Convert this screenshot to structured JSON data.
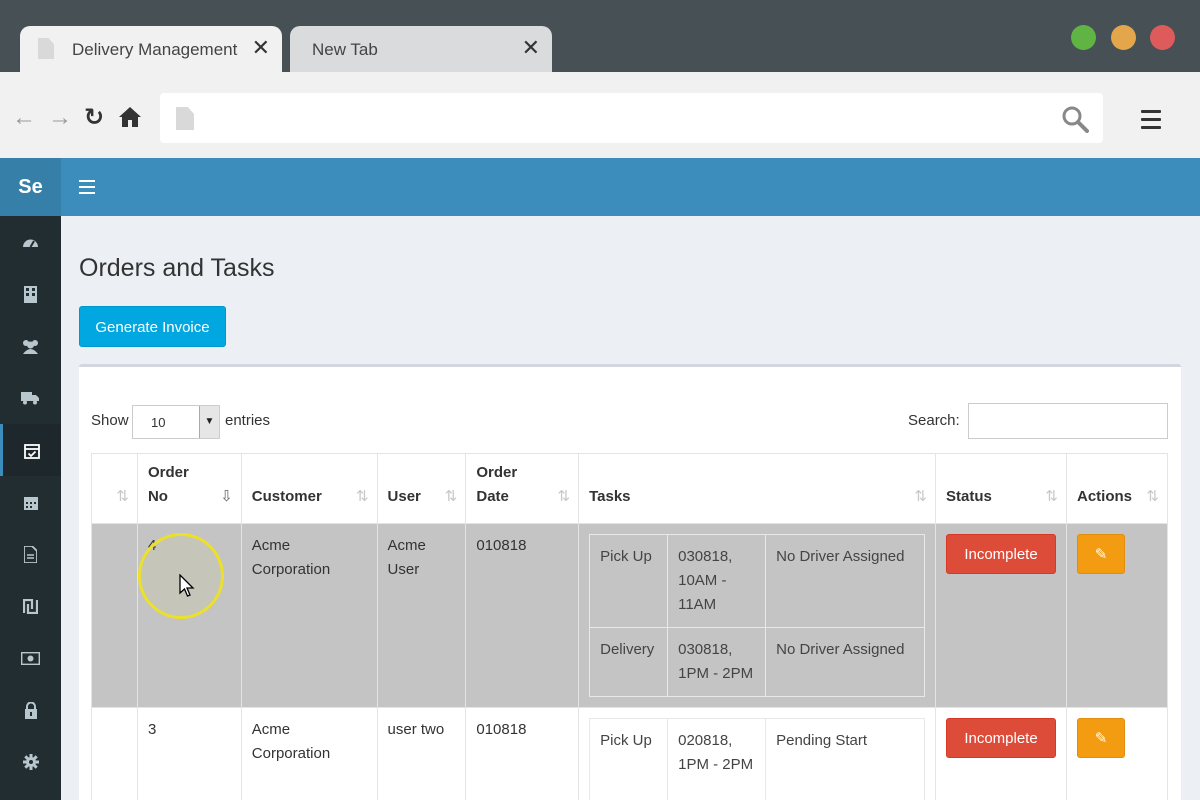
{
  "browser": {
    "tabs": [
      {
        "title": "Delivery Management",
        "close": "✕"
      },
      {
        "title": "New Tab",
        "close": "✕"
      }
    ],
    "url": "",
    "icons": {
      "back": "back-arrow-icon",
      "forward": "forward-arrow-icon",
      "reload": "reload-icon",
      "home": "home-icon",
      "search": "search-icon",
      "menu": "menu-icon"
    },
    "lights": {
      "green": "#5fb443",
      "yellow": "#e3a64a",
      "red": "#dd5c5b"
    }
  },
  "app": {
    "brand": "Se",
    "sidebar_icons": [
      "dashboard-icon",
      "building-icon",
      "users-icon",
      "truck-icon",
      "calendar-check-icon",
      "calendar-icon",
      "file-icon",
      "shekel-icon",
      "money-icon",
      "lock-icon",
      "gear-icon"
    ],
    "accent": "#3c8dbc"
  },
  "page": {
    "title": "Orders and Tasks",
    "generate_invoice": "Generate Invoice",
    "show_label": "Show",
    "length_value": "10",
    "entries_label": "entries",
    "search_label": "Search:",
    "columns": [
      "",
      "Order No",
      "Customer",
      "User",
      "Order Date",
      "Tasks",
      "Status",
      "Actions"
    ],
    "rows": [
      {
        "order_no": "4",
        "customer": "Acme Corporation",
        "user": "Acme User",
        "order_date": "010818",
        "tasks": [
          {
            "type": "Pick Up",
            "time": "030818, 10AM - 11AM",
            "driver": "No Driver Assigned"
          },
          {
            "type": "Delivery",
            "time": "030818, 1PM - 2PM",
            "driver": "No Driver Assigned"
          }
        ],
        "status": "Incomplete"
      },
      {
        "order_no": "3",
        "customer": "Acme Corporation",
        "user": "user two",
        "order_date": "010818",
        "tasks": [
          {
            "type": "Pick Up",
            "time": "020818, 1PM - 2PM",
            "driver": "Pending Start"
          }
        ],
        "status": "Incomplete"
      }
    ]
  }
}
